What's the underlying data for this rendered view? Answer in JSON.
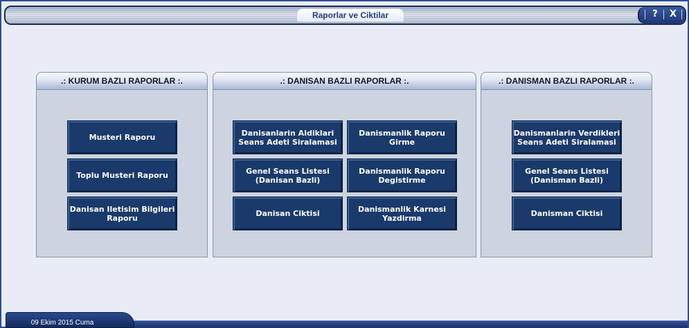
{
  "window": {
    "title": "Raporlar ve Ciktilar",
    "help_label": "?",
    "close_label": "X"
  },
  "panels": [
    {
      "header": ".: KURUM BAZLI RAPORLAR :.",
      "buttons": [
        "Musteri Raporu",
        "Toplu Musteri Raporu",
        "Danisan Iletisim Bilgileri\nRaporu"
      ]
    },
    {
      "header": ".: DANISAN BAZLI RAPORLAR :.",
      "buttons": [
        "Danisanlarin Aldiklari\nSeans Adeti Siralamasi",
        "Danismanlik Raporu\nGirme",
        "Genel Seans Listesi\n(Danisan Bazli)",
        "Danismanlik Raporu\nDegistirme",
        "Danisan Ciktisi",
        "Danismanlik Karnesi\nYazdirma"
      ]
    },
    {
      "header": ".: DANISMAN BAZLI RAPORLAR :.",
      "buttons": [
        "Danismanlarin Verdikleri\nSeans Adeti Siralamasi",
        "Genel Seans Listesi\n(Danisman Bazli)",
        "Danisman Ciktisi"
      ]
    }
  ],
  "status": {
    "date": "09 Ekim 2015 Cuma"
  }
}
